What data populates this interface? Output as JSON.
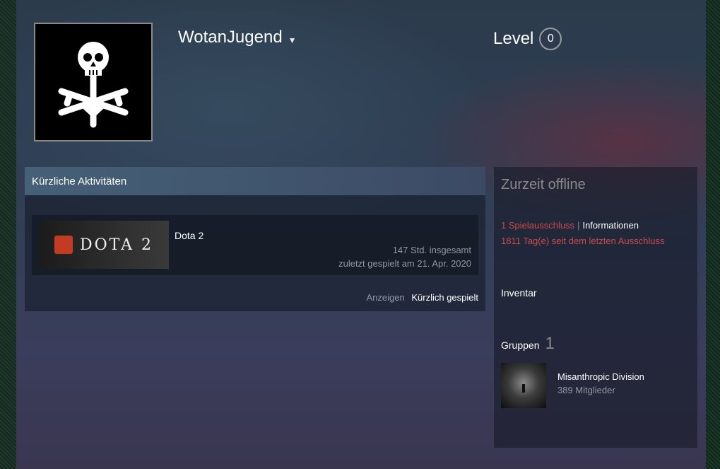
{
  "profile": {
    "persona_name": "WotanJugend",
    "level_label": "Level",
    "level_value": "0"
  },
  "activity": {
    "header": "Kürzliche Aktivitäten",
    "game": {
      "capsule_text": "DOTA 2",
      "name": "Dota 2",
      "hours": "147 Std. insgesamt",
      "last_played": "zuletzt gespielt am 21. Apr. 2020"
    },
    "footer_label": "Anzeigen",
    "footer_link": "Kürzlich gespielt"
  },
  "sidebar": {
    "status": "Zurzeit offline",
    "ban_count": "1 Spielausschluss",
    "ban_separator": "|",
    "ban_info_link": "Informationen",
    "ban_days": "1811 Tag(e) seit dem letzten Ausschluss",
    "inventory": "Inventar",
    "groups_label": "Gruppen",
    "groups_count": "1",
    "group": {
      "name": "Misanthropic Division",
      "members": "389 Mitglieder"
    }
  },
  "colors": {
    "ban_red": "#cb4b4b",
    "dota_red": "#c23b22"
  }
}
